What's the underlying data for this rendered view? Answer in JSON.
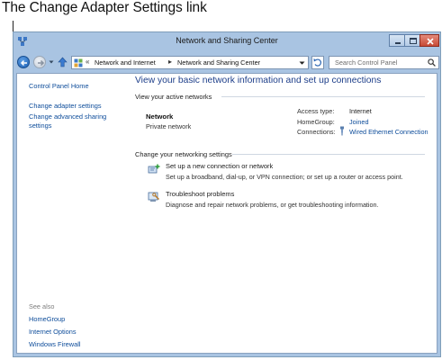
{
  "callout": {
    "title": "The Change Adapter Settings link"
  },
  "window": {
    "title": "Network and Sharing Center"
  },
  "address_bar": {
    "overflow_marker": "«",
    "crumbs": [
      "Network and Internet",
      "Network and Sharing Center"
    ],
    "separator": "▸",
    "search_placeholder": "Search Control Panel"
  },
  "sidebar": {
    "home": "Control Panel Home",
    "items": [
      {
        "label": "Change adapter settings"
      },
      {
        "label": "Change advanced sharing settings"
      }
    ],
    "see_also_label": "See also",
    "see_also": [
      {
        "label": "HomeGroup"
      },
      {
        "label": "Internet Options"
      },
      {
        "label": "Windows Firewall"
      }
    ]
  },
  "main": {
    "title": "View your basic network information and set up connections",
    "active_networks_label": "View your active networks",
    "network": {
      "name": "Network",
      "type": "Private network",
      "access_type_label": "Access type:",
      "access_type_value": "Internet",
      "homegroup_label": "HomeGroup:",
      "homegroup_value": "Joined",
      "connections_label": "Connections:",
      "connections_value": "Wired Ethernet Connection"
    },
    "settings_label": "Change your networking settings",
    "tasks": [
      {
        "icon": "new-connection-icon",
        "label": "Set up a new connection or network",
        "desc": "Set up a broadband, dial-up, or VPN connection; or set up a router or access point."
      },
      {
        "icon": "troubleshoot-icon",
        "label": "Troubleshoot problems",
        "desc": "Diagnose and repair network problems, or get troubleshooting information."
      }
    ]
  },
  "colors": {
    "link": "#0d4c9a",
    "title": "#1e3f8a",
    "frame": "#a9c4e2",
    "close_button": "#c74a36"
  }
}
